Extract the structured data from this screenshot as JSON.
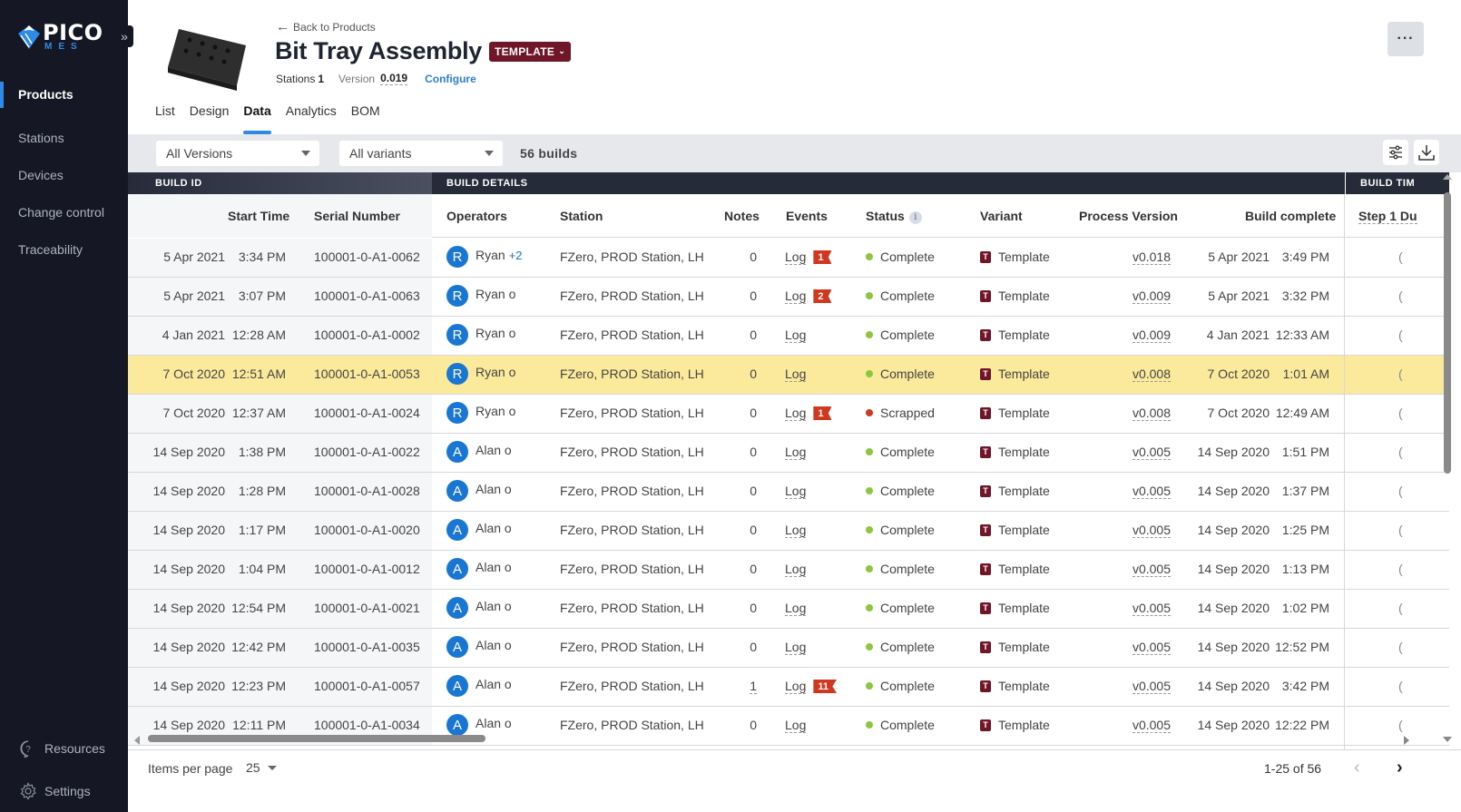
{
  "sidebar": {
    "logo_top": "PICO",
    "logo_bottom": "MES",
    "items": [
      {
        "label": "Products",
        "active": true
      },
      {
        "label": "Stations"
      },
      {
        "label": "Devices"
      },
      {
        "label": "Change control"
      },
      {
        "label": "Traceability"
      }
    ],
    "bottom": [
      {
        "label": "Resources",
        "icon": "help-icon"
      },
      {
        "label": "Settings",
        "icon": "gear-icon"
      }
    ]
  },
  "header": {
    "back_label": "Back to Products",
    "title": "Bit Tray Assembly",
    "badge": "TEMPLATE",
    "stations_label": "Stations",
    "stations_value": "1",
    "version_label": "Version",
    "version_value": "0.019",
    "configure_label": "Configure",
    "more_label": "···"
  },
  "tabs": [
    {
      "label": "List"
    },
    {
      "label": "Design"
    },
    {
      "label": "Data",
      "active": true
    },
    {
      "label": "Analytics"
    },
    {
      "label": "BOM"
    }
  ],
  "toolbar": {
    "versions_value": "All Versions",
    "variants_value": "All variants",
    "builds_count": "56 builds"
  },
  "table": {
    "groups": {
      "build_id": "BUILD ID",
      "build_details": "BUILD DETAILS",
      "build_time": "BUILD TIM"
    },
    "columns": {
      "start_time": "Start Time",
      "serial": "Serial Number",
      "operators": "Operators",
      "station": "Station",
      "notes": "Notes",
      "events": "Events",
      "status": "Status",
      "variant": "Variant",
      "process_version": "Process Version",
      "build_complete": "Build complete",
      "step1": "Step 1 Du"
    },
    "status_colors": {
      "Complete": "#8dc63f",
      "Scrapped": "#d0391f"
    },
    "rows": [
      {
        "start_date": "5 Apr 2021",
        "start_time": "3:34 PM",
        "serial": "100001-0-A1-0062",
        "op_initial": "R",
        "op_name": "Ryan",
        "op_more": "+2",
        "station": "FZero, PROD Station, LH",
        "notes": "0",
        "log": "Log",
        "events": "1",
        "status": "Complete",
        "variant": "Template",
        "pv": "v0.018",
        "end_date": "5 Apr 2021",
        "end_time": "3:49 PM"
      },
      {
        "start_date": "5 Apr 2021",
        "start_time": "3:07 PM",
        "serial": "100001-0-A1-0063",
        "op_initial": "R",
        "op_name": "Ryan o",
        "op_more": "",
        "station": "FZero, PROD Station, LH",
        "notes": "0",
        "log": "Log",
        "events": "2",
        "status": "Complete",
        "variant": "Template",
        "pv": "v0.009",
        "end_date": "5 Apr 2021",
        "end_time": "3:32 PM"
      },
      {
        "start_date": "4 Jan 2021",
        "start_time": "12:28 AM",
        "serial": "100001-0-A1-0002",
        "op_initial": "R",
        "op_name": "Ryan o",
        "op_more": "",
        "station": "FZero, PROD Station, LH",
        "notes": "0",
        "log": "Log",
        "events": "",
        "status": "Complete",
        "variant": "Template",
        "pv": "v0.009",
        "end_date": "4 Jan 2021",
        "end_time": "12:33 AM"
      },
      {
        "start_date": "7 Oct 2020",
        "start_time": "12:51 AM",
        "serial": "100001-0-A1-0053",
        "op_initial": "R",
        "op_name": "Ryan o",
        "op_more": "",
        "station": "FZero, PROD Station, LH",
        "notes": "0",
        "log": "Log",
        "events": "",
        "status": "Complete",
        "variant": "Template",
        "pv": "v0.008",
        "end_date": "7 Oct 2020",
        "end_time": "1:01 AM",
        "highlighted": true
      },
      {
        "start_date": "7 Oct 2020",
        "start_time": "12:37 AM",
        "serial": "100001-0-A1-0024",
        "op_initial": "R",
        "op_name": "Ryan o",
        "op_more": "",
        "station": "FZero, PROD Station, LH",
        "notes": "0",
        "log": "Log",
        "events": "1",
        "status": "Scrapped",
        "variant": "Template",
        "pv": "v0.008",
        "end_date": "7 Oct 2020",
        "end_time": "12:49 AM"
      },
      {
        "start_date": "14 Sep 2020",
        "start_time": "1:38 PM",
        "serial": "100001-0-A1-0022",
        "op_initial": "A",
        "op_name": "Alan o",
        "op_more": "",
        "station": "FZero, PROD Station, LH",
        "notes": "0",
        "log": "Log",
        "events": "",
        "status": "Complete",
        "variant": "Template",
        "pv": "v0.005",
        "end_date": "14 Sep 2020",
        "end_time": "1:51 PM"
      },
      {
        "start_date": "14 Sep 2020",
        "start_time": "1:28 PM",
        "serial": "100001-0-A1-0028",
        "op_initial": "A",
        "op_name": "Alan o",
        "op_more": "",
        "station": "FZero, PROD Station, LH",
        "notes": "0",
        "log": "Log",
        "events": "",
        "status": "Complete",
        "variant": "Template",
        "pv": "v0.005",
        "end_date": "14 Sep 2020",
        "end_time": "1:37 PM"
      },
      {
        "start_date": "14 Sep 2020",
        "start_time": "1:17 PM",
        "serial": "100001-0-A1-0020",
        "op_initial": "A",
        "op_name": "Alan o",
        "op_more": "",
        "station": "FZero, PROD Station, LH",
        "notes": "0",
        "log": "Log",
        "events": "",
        "status": "Complete",
        "variant": "Template",
        "pv": "v0.005",
        "end_date": "14 Sep 2020",
        "end_time": "1:25 PM"
      },
      {
        "start_date": "14 Sep 2020",
        "start_time": "1:04 PM",
        "serial": "100001-0-A1-0012",
        "op_initial": "A",
        "op_name": "Alan o",
        "op_more": "",
        "station": "FZero, PROD Station, LH",
        "notes": "0",
        "log": "Log",
        "events": "",
        "status": "Complete",
        "variant": "Template",
        "pv": "v0.005",
        "end_date": "14 Sep 2020",
        "end_time": "1:13 PM"
      },
      {
        "start_date": "14 Sep 2020",
        "start_time": "12:54 PM",
        "serial": "100001-0-A1-0021",
        "op_initial": "A",
        "op_name": "Alan o",
        "op_more": "",
        "station": "FZero, PROD Station, LH",
        "notes": "0",
        "log": "Log",
        "events": "",
        "status": "Complete",
        "variant": "Template",
        "pv": "v0.005",
        "end_date": "14 Sep 2020",
        "end_time": "1:02 PM"
      },
      {
        "start_date": "14 Sep 2020",
        "start_time": "12:42 PM",
        "serial": "100001-0-A1-0035",
        "op_initial": "A",
        "op_name": "Alan o",
        "op_more": "",
        "station": "FZero, PROD Station, LH",
        "notes": "0",
        "log": "Log",
        "events": "",
        "status": "Complete",
        "variant": "Template",
        "pv": "v0.005",
        "end_date": "14 Sep 2020",
        "end_time": "12:52 PM"
      },
      {
        "start_date": "14 Sep 2020",
        "start_time": "12:23 PM",
        "serial": "100001-0-A1-0057",
        "op_initial": "A",
        "op_name": "Alan o",
        "op_more": "",
        "station": "FZero, PROD Station, LH",
        "notes": "1",
        "log": "Log",
        "events": "11",
        "status": "Complete",
        "variant": "Template",
        "pv": "v0.005",
        "end_date": "14 Sep 2020",
        "end_time": "3:42 PM"
      },
      {
        "start_date": "14 Sep 2020",
        "start_time": "12:11 PM",
        "serial": "100001-0-A1-0034",
        "op_initial": "A",
        "op_name": "Alan o",
        "op_more": "",
        "station": "FZero, PROD Station, LH",
        "notes": "0",
        "log": "Log",
        "events": "",
        "status": "Complete",
        "variant": "Template",
        "pv": "v0.005",
        "end_date": "14 Sep 2020",
        "end_time": "12:22 PM"
      }
    ]
  },
  "footer": {
    "items_per_page_label": "Items per page",
    "items_per_page_value": "25",
    "range": "1-25 of 56"
  }
}
